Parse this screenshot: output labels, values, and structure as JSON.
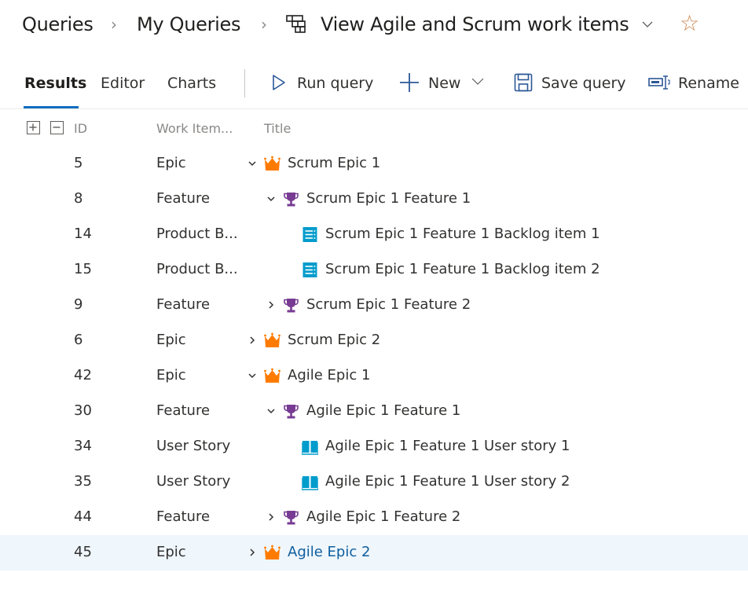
{
  "breadcrumb": {
    "items": [
      "Queries",
      "My Queries"
    ],
    "query_title": "View Agile and Scrum work items",
    "query_icon": "tree-query-icon",
    "favorite_icon": "star-outline-icon"
  },
  "tabs": [
    {
      "label": "Results",
      "active": true
    },
    {
      "label": "Editor",
      "active": false
    },
    {
      "label": "Charts",
      "active": false
    }
  ],
  "commands": [
    {
      "label": "Run query",
      "icon": "play-icon"
    },
    {
      "label": "New",
      "icon": "plus-icon",
      "has_dropdown": true
    },
    {
      "label": "Save query",
      "icon": "save-icon"
    },
    {
      "label": "Rename",
      "icon": "rename-icon"
    }
  ],
  "columns": {
    "expand_all_icon": "expand-all-icon",
    "collapse_all_icon": "collapse-all-icon",
    "id": "ID",
    "type": "Work Item...",
    "title": "Title"
  },
  "colors": {
    "epic": "#ff7b00",
    "feature": "#773b93",
    "backlog_item": "#009ccc",
    "user_story": "#009ccc",
    "accent": "#106ebe",
    "selected_row": "#eff6fc",
    "star": "#c8854f"
  },
  "rows": [
    {
      "id": "5",
      "type": "Epic",
      "title": "Scrum Epic 1",
      "level": 0,
      "expander": "expanded",
      "icon": "crown-icon"
    },
    {
      "id": "8",
      "type": "Feature",
      "title": "Scrum Epic 1 Feature 1",
      "level": 1,
      "expander": "expanded",
      "icon": "trophy-icon"
    },
    {
      "id": "14",
      "type": "Product B...",
      "title": "Scrum Epic 1 Feature 1 Backlog item 1",
      "level": 2,
      "expander": "none",
      "icon": "backlog-item-icon"
    },
    {
      "id": "15",
      "type": "Product B...",
      "title": "Scrum Epic 1 Feature 1 Backlog item 2",
      "level": 2,
      "expander": "none",
      "icon": "backlog-item-icon"
    },
    {
      "id": "9",
      "type": "Feature",
      "title": "Scrum Epic 1 Feature 2",
      "level": 1,
      "expander": "collapsed",
      "icon": "trophy-icon"
    },
    {
      "id": "6",
      "type": "Epic",
      "title": "Scrum Epic 2",
      "level": 0,
      "expander": "collapsed",
      "icon": "crown-icon"
    },
    {
      "id": "42",
      "type": "Epic",
      "title": "Agile Epic 1",
      "level": 0,
      "expander": "expanded",
      "icon": "crown-icon"
    },
    {
      "id": "30",
      "type": "Feature",
      "title": "Agile Epic 1 Feature 1",
      "level": 1,
      "expander": "expanded",
      "icon": "trophy-icon"
    },
    {
      "id": "34",
      "type": "User Story",
      "title": "Agile Epic 1 Feature 1 User story 1",
      "level": 2,
      "expander": "none",
      "icon": "book-icon"
    },
    {
      "id": "35",
      "type": "User Story",
      "title": "Agile Epic 1 Feature 1 User story 2",
      "level": 2,
      "expander": "none",
      "icon": "book-icon"
    },
    {
      "id": "44",
      "type": "Feature",
      "title": "Agile Epic 1 Feature 2",
      "level": 1,
      "expander": "collapsed",
      "icon": "trophy-icon"
    },
    {
      "id": "45",
      "type": "Epic",
      "title": "Agile Epic 2",
      "level": 0,
      "expander": "collapsed",
      "icon": "crown-icon",
      "selected": true
    }
  ]
}
